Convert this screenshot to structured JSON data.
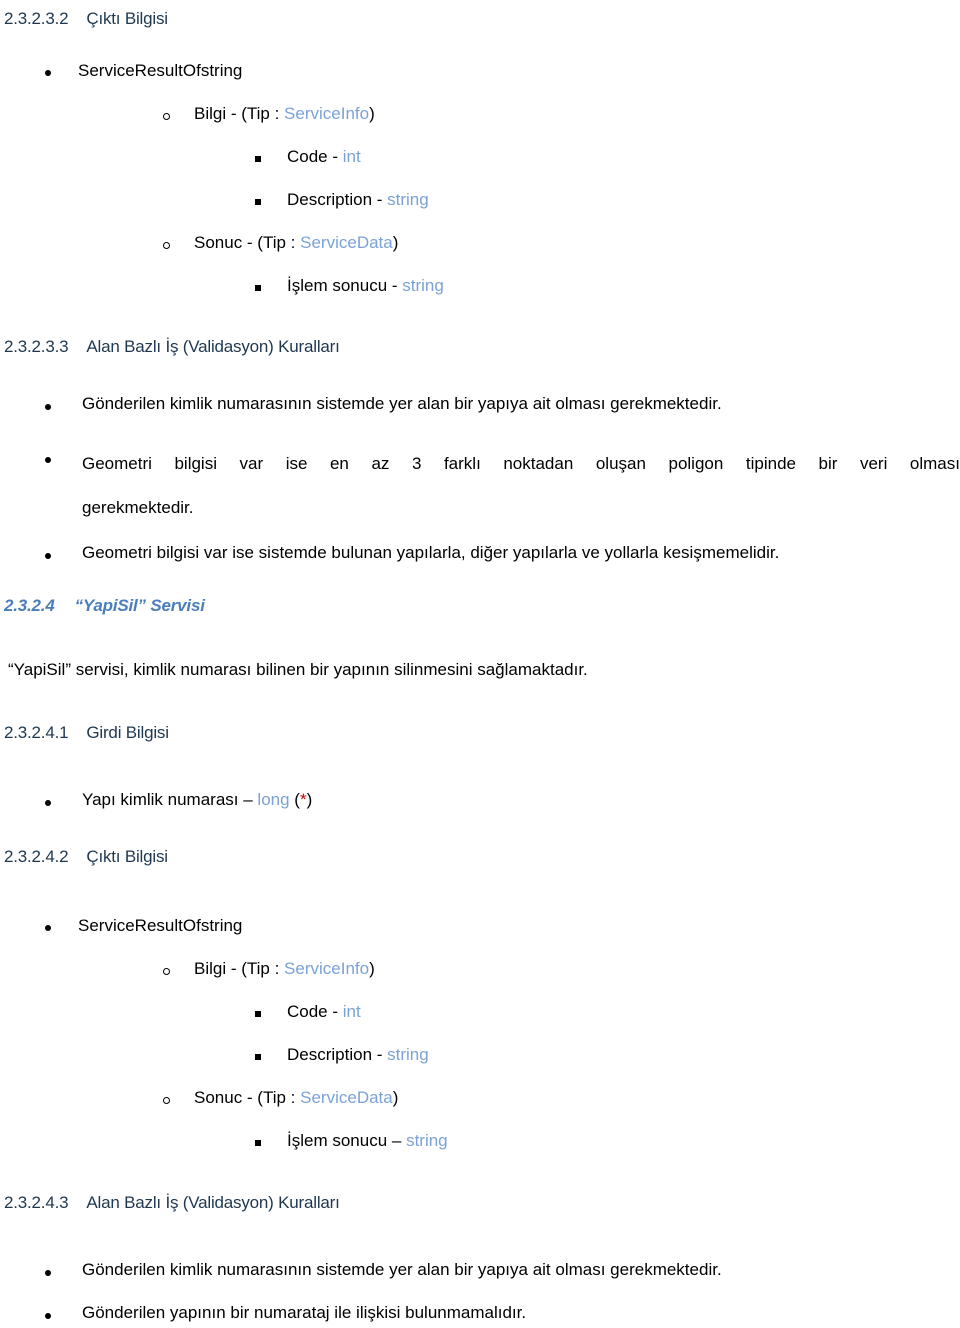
{
  "document": {
    "language": "tr",
    "colors": {
      "heading_navy": "#1f3850",
      "service_heading_blue": "#4a7ebb",
      "type_blue": "#7ba2d6",
      "required_star_red": "#c00000",
      "body_black": "#000000",
      "page_background": "#ffffff"
    }
  },
  "sections": {
    "output_info_1": {
      "number": "2.3.2.3.2",
      "title": "Çıktı Bilgisi"
    },
    "validation_rules_1": {
      "number": "2.3.2.3.3",
      "title": "Alan Bazlı İş (Validasyon) Kuralları"
    },
    "yapisil_service": {
      "number": "2.3.2.4",
      "title": "“YapiSil” Servisi",
      "description": "“YapiSil” servisi, kimlik numarası bilinen bir yapının silinmesini sağlamaktadır."
    },
    "input_info": {
      "number": "2.3.2.4.1",
      "title": "Girdi Bilgisi"
    },
    "output_info_2": {
      "number": "2.3.2.4.2",
      "title": "Çıktı Bilgisi"
    },
    "validation_rules_2": {
      "number": "2.3.2.4.3",
      "title": "Alan Bazlı İş (Validasyon) Kuralları"
    }
  },
  "result_tree_top": {
    "root": "ServiceResultOfstring",
    "bilgi": {
      "label": "Bilgi -  (Tip : ",
      "type": "ServiceInfo",
      "close": ")",
      "fields": [
        {
          "name": "Code - ",
          "type": "int"
        },
        {
          "name": "Description - ",
          "type": "string"
        }
      ]
    },
    "sonuc": {
      "label": "Sonuc -  (Tip : ",
      "type": "ServiceData",
      "close": ")",
      "fields": [
        {
          "name": "İşlem sonucu - ",
          "type": "string"
        }
      ]
    }
  },
  "result_tree_bottom": {
    "root": "ServiceResultOfstring",
    "bilgi": {
      "label": "Bilgi -  (Tip : ",
      "type": "ServiceInfo",
      "close": ")",
      "fields": [
        {
          "name": "Code - ",
          "type": "int"
        },
        {
          "name": "Description - ",
          "type": "string"
        }
      ]
    },
    "sonuc": {
      "label": "Sonuc -  (Tip : ",
      "type": "ServiceData",
      "close": ")",
      "fields": [
        {
          "name": "İşlem sonucu – ",
          "type": "string"
        }
      ]
    }
  },
  "input_fields": [
    {
      "name": "Yapı kimlik numarası – ",
      "type": "long",
      "required_open": " (",
      "required_mark": "*",
      "required_close": ")"
    }
  ],
  "validation_list_1": {
    "item1": "Gönderilen kimlik numarasının sistemde yer alan bir yapıya ait olması gerekmektedir.",
    "item2_line1": "Geometri bilgisi var ise en az 3 farklı noktadan oluşan poligon tipinde bir veri olması",
    "item2_line2": "gerekmektedir.",
    "item3": "Geometri bilgisi var ise sistemde bulunan yapılarla, diğer yapılarla ve yollarla kesişmemelidir."
  },
  "validation_list_2": {
    "item1": "Gönderilen kimlik numarasının sistemde yer alan bir yapıya ait olması gerekmektedir.",
    "item2": "Gönderilen yapının bir numarataj ile ilişkisi bulunmamalıdır."
  }
}
